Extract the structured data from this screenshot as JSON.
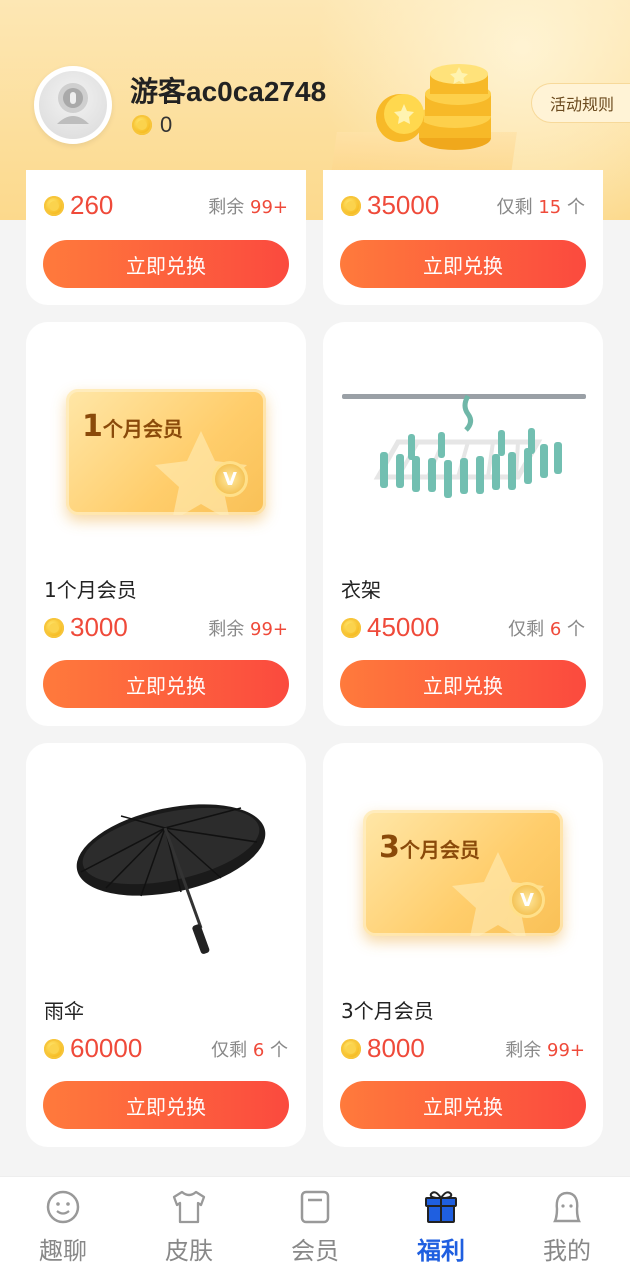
{
  "header": {
    "username": "游客ac0ca2748",
    "coins": "0",
    "rules_label": "活动规则"
  },
  "items": [
    {
      "name": "",
      "price": "260",
      "stock_prefix": "剩余",
      "stock_num": "99+",
      "stock_suffix": "",
      "button": "立即兑换"
    },
    {
      "name": "",
      "price": "35000",
      "stock_prefix": "仅剩",
      "stock_num": "15",
      "stock_suffix": "个",
      "button": "立即兑换"
    },
    {
      "name": "1个月会员",
      "price": "3000",
      "stock_prefix": "剩余",
      "stock_num": "99+",
      "stock_suffix": "",
      "button": "立即兑换",
      "card_num": "1",
      "card_text": "个月会员"
    },
    {
      "name": "衣架",
      "price": "45000",
      "stock_prefix": "仅剩",
      "stock_num": "6",
      "stock_suffix": "个",
      "button": "立即兑换"
    },
    {
      "name": "雨伞",
      "price": "60000",
      "stock_prefix": "仅剩",
      "stock_num": "6",
      "stock_suffix": "个",
      "button": "立即兑换"
    },
    {
      "name": "3个月会员",
      "price": "8000",
      "stock_prefix": "剩余",
      "stock_num": "99+",
      "stock_suffix": "",
      "button": "立即兑换",
      "card_num": "3",
      "card_text": "个月会员"
    }
  ],
  "tabs": [
    {
      "label": "趣聊",
      "icon": "smile-icon",
      "active": false
    },
    {
      "label": "皮肤",
      "icon": "shirt-icon",
      "active": false
    },
    {
      "label": "会员",
      "icon": "card-icon",
      "active": false
    },
    {
      "label": "福利",
      "icon": "gift-icon",
      "active": true
    },
    {
      "label": "我的",
      "icon": "user-icon",
      "active": false
    }
  ],
  "colors": {
    "accent": "#1f5fe0",
    "price": "#ef4a3a",
    "button_start": "#ff7a3c",
    "button_end": "#fb4a3e"
  }
}
